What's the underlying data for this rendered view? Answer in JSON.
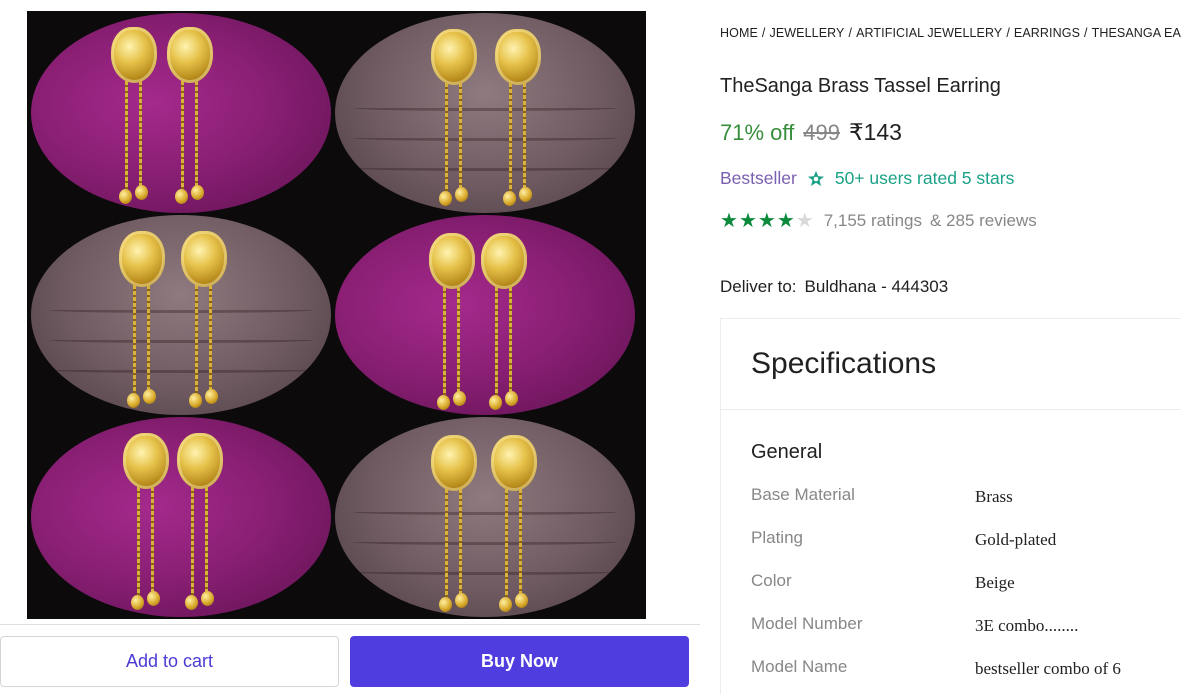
{
  "breadcrumb": {
    "items": [
      "HOME",
      "JEWELLERY",
      "ARTIFICIAL JEWELLERY",
      "EARRINGS",
      "THESANGA EARRINGS"
    ],
    "separator": "/"
  },
  "product": {
    "title": "TheSanga Brass Tassel Earring",
    "discount": "71% off",
    "mrp": "499",
    "price": "₹143",
    "bestseller_label": "Bestseller",
    "users_rated": "50+ users rated 5 stars",
    "rating_stars": 4,
    "ratings_count": "7,155 ratings",
    "reviews_count": "& 285 reviews"
  },
  "delivery": {
    "label": "Deliver to:",
    "location": "Buldhana - 444303"
  },
  "specifications": {
    "heading": "Specifications",
    "section": "General",
    "rows": [
      {
        "key": "Base Material",
        "value": "Brass"
      },
      {
        "key": "Plating",
        "value": "Gold-plated"
      },
      {
        "key": "Color",
        "value": "Beige"
      },
      {
        "key": "Model Number",
        "value": "3E combo........"
      },
      {
        "key": "Model Name",
        "value": "bestseller combo of 6"
      }
    ]
  },
  "actions": {
    "add_to_cart": "Add to cart",
    "buy_now": "Buy Now"
  },
  "colors": {
    "discount_green": "#388e3c",
    "brand_purple": "#4f3de0",
    "bestseller_purple": "#7b5fb0",
    "rating_teal": "#1aa186",
    "star_green": "#0b8a3c"
  },
  "icons": {
    "rating_badge": "star-badge-icon",
    "rating_star": "star-icon"
  }
}
